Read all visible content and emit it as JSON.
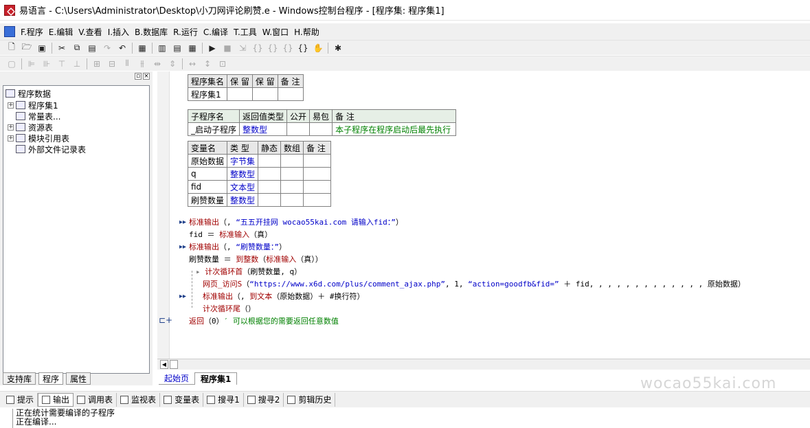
{
  "titlebar": {
    "title": "易语言 - C:\\Users\\Administrator\\Desktop\\小刀网评论刷赞.e - Windows控制台程序 - [程序集: 程序集1]"
  },
  "menu": [
    "F.程序",
    "E.编辑",
    "V.查看",
    "I.插入",
    "B.数据库",
    "R.运行",
    "C.编译",
    "T.工具",
    "W.窗口",
    "H.帮助"
  ],
  "tree": {
    "root": "程序数据",
    "items": [
      "程序集1",
      "常量表...",
      "资源表",
      "模块引用表",
      "外部文件记录表"
    ]
  },
  "left_tabs": [
    "支持库",
    "程序",
    "属性"
  ],
  "t1": {
    "headers": [
      "程序集名",
      "保 留",
      "保 留",
      "备 注"
    ],
    "row": [
      "程序集1",
      "",
      "",
      ""
    ]
  },
  "t2": {
    "headers": [
      "子程序名",
      "返回值类型",
      "公开",
      "易包",
      "备 注"
    ],
    "row": [
      "_启动子程序",
      "整数型",
      "",
      "",
      "本子程序在程序启动后最先执行"
    ]
  },
  "t3": {
    "headers": [
      "变量名",
      "类 型",
      "静态",
      "数组",
      "备 注"
    ],
    "rows": [
      [
        "原始数据",
        "字节集"
      ],
      [
        "q",
        "整数型"
      ],
      [
        "fid",
        "文本型"
      ],
      [
        "刷赞数量",
        "整数型"
      ]
    ]
  },
  "code": {
    "l1a": "标准输出",
    "l1b": "（, ",
    "l1c": "“五五开挂网 wocao55kai.com 请输入fid：”",
    "l1d": "）",
    "l2a": "fid ＝ ",
    "l2b": "标准输入",
    "l2c": "（真）",
    "l3a": "标准输出",
    "l3b": "（, ",
    "l3c": "“刷赞数量：”",
    "l3d": "）",
    "l4a": "刷赞数量 ＝ ",
    "l4b": "到整数",
    "l4c": "（",
    "l4d": "标准输入",
    "l4e": "（真））",
    "l5a": "计次循环首",
    "l5b": "（刷赞数量, q）",
    "l6a": "网页_访问S",
    "l6b": "（",
    "l6c": "“https://www.x6d.com/plus/comment_ajax.php”",
    "l6d": ", 1, ",
    "l6e": "“action=goodfb&fid=”",
    "l6f": " ＋ fid, , , , , , , , , , , , , 原始数据）",
    "l7a": "标准输出",
    "l7b": "（, ",
    "l7c": "到文本",
    "l7d": "（原始数据）＋ #换行符）",
    "l8a": "计次循环尾",
    "l8b": "（）",
    "l9a": "返回",
    "l9b": "（0）",
    "l9c": "′ 可以根据您的需要返回任意数值"
  },
  "editor_tabs": [
    "起始页",
    "程序集1"
  ],
  "watermark": "wocao55kai.com",
  "bottom_tabs": [
    "提示",
    "输出",
    "调用表",
    "监视表",
    "变量表",
    "搜寻1",
    "搜寻2",
    "剪辑历史"
  ],
  "output": {
    "line1": "正在统计需要编译的子程序",
    "line2": "正在编译..."
  }
}
